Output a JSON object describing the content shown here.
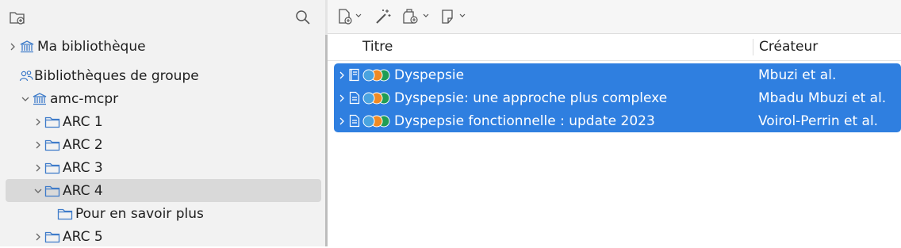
{
  "sidebar": {
    "toolbar": {
      "new_collection_icon": "folder-plus-icon",
      "search_icon": "search-icon"
    },
    "items": [
      {
        "label": "Ma bibliothèque",
        "icon": "library-icon",
        "twisty": "collapsed"
      },
      {
        "label": "Bibliothèques de groupe",
        "icon": "group-icon",
        "twisty": "none"
      },
      {
        "label": "amc-mcpr",
        "icon": "library-icon",
        "twisty": "expanded"
      },
      {
        "label": "ARC 1",
        "icon": "folder-icon",
        "twisty": "collapsed"
      },
      {
        "label": "ARC 2",
        "icon": "folder-icon",
        "twisty": "collapsed"
      },
      {
        "label": "ARC 3",
        "icon": "folder-icon",
        "twisty": "collapsed"
      },
      {
        "label": "ARC 4",
        "icon": "folder-icon",
        "twisty": "expanded",
        "selected": true
      },
      {
        "label": "Pour en savoir plus",
        "icon": "folder-icon",
        "twisty": "none"
      },
      {
        "label": "ARC 5",
        "icon": "folder-icon",
        "twisty": "collapsed"
      }
    ]
  },
  "toolbar": {
    "buttons": [
      "new-item-icon",
      "magic-wand-icon",
      "add-attachment-icon",
      "new-note-icon"
    ]
  },
  "table": {
    "columns": [
      "Titre",
      "Créateur"
    ],
    "rows": [
      {
        "title": "Dyspepsie",
        "creator": "Mbuzi et al.",
        "type_icon": "book-icon"
      },
      {
        "title": "Dyspepsie: une approche plus complexe",
        "creator": "Mbadu Mbuzi et al.",
        "type_icon": "document-icon"
      },
      {
        "title": "Dyspepsie fonctionnelle : update 2023",
        "creator": "Voirol-Perrin et al.",
        "type_icon": "document-icon"
      }
    ],
    "selection_color": "#2f7fe0",
    "tag_colors": [
      "#4aa3df",
      "#f08a24",
      "#1f9d55"
    ]
  }
}
